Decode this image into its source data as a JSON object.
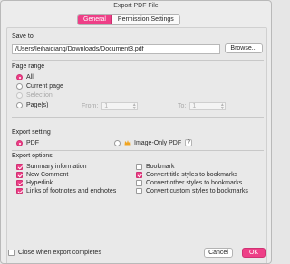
{
  "window": {
    "title": "Export PDF File"
  },
  "tabs": [
    {
      "label": "General",
      "active": true
    },
    {
      "label": "Permission Settings",
      "active": false
    }
  ],
  "save_to": {
    "label": "Save to",
    "path": "/Users/leihaiqiang/Downloads/Document3.pdf",
    "browse_label": "Browse..."
  },
  "page_range": {
    "label": "Page range",
    "options": [
      {
        "label": "All",
        "checked": true,
        "enabled": true
      },
      {
        "label": "Current page",
        "checked": false,
        "enabled": true
      },
      {
        "label": "Selection",
        "checked": false,
        "enabled": false
      },
      {
        "label": "Page(s)",
        "checked": false,
        "enabled": true
      }
    ],
    "from_label": "From:",
    "from_value": "1",
    "to_label": "To:",
    "to_value": "1"
  },
  "export_setting": {
    "label": "Export setting",
    "pdf_label": "PDF",
    "image_pdf_label": "Image-Only PDF",
    "help_icon": "?"
  },
  "export_options": {
    "label": "Export options",
    "left": [
      {
        "label": "Summary information",
        "checked": true
      },
      {
        "label": "New Comment",
        "checked": true
      },
      {
        "label": "Hyperlink",
        "checked": true
      },
      {
        "label": "Links of footnotes and endnotes",
        "checked": true
      }
    ],
    "right": [
      {
        "label": "Bookmark",
        "checked": false
      },
      {
        "label": "Convert title styles to bookmarks",
        "checked": true
      },
      {
        "label": "Convert other styles to bookmarks",
        "checked": false
      },
      {
        "label": "Convert custom styles to bookmarks",
        "checked": false
      }
    ]
  },
  "footer": {
    "close_label": "Close when export completes",
    "cancel_label": "Cancel",
    "ok_label": "OK"
  },
  "colors": {
    "accent": "#ee3f87",
    "window_bg": "#ececec"
  }
}
